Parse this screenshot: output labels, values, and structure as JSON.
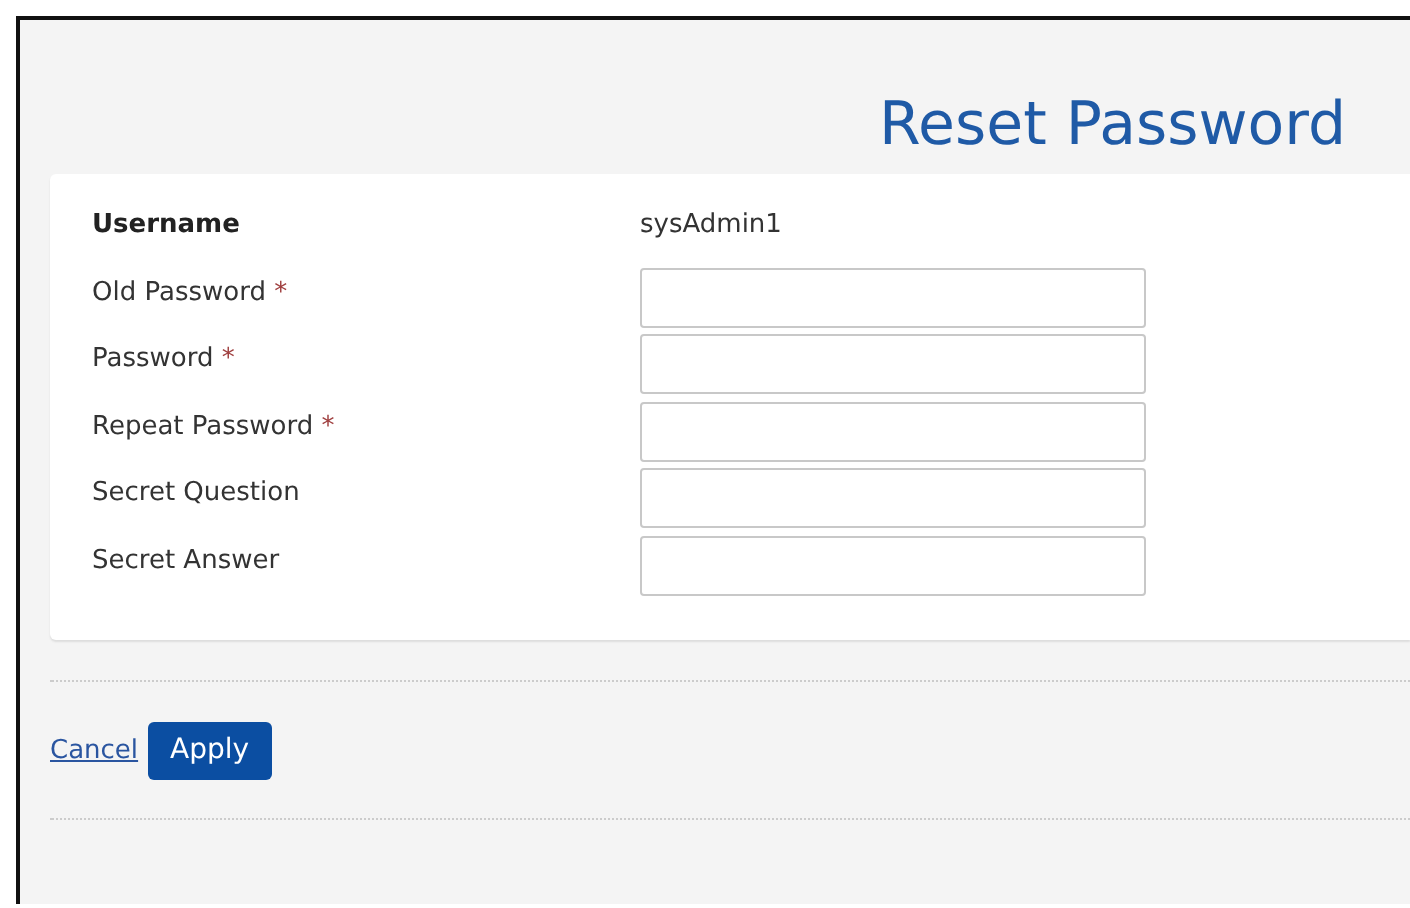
{
  "title": "Reset Password",
  "fields": [
    {
      "kind": "text",
      "label": "Username",
      "value": "sysAdmin1"
    },
    {
      "kind": "input",
      "label": "Old Password",
      "mark": "*"
    },
    {
      "kind": "input",
      "label": "Password",
      "mark": "*"
    },
    {
      "kind": "input",
      "label": "Repeat Password",
      "mark": "*"
    },
    {
      "kind": "input",
      "label": "Secret Question"
    },
    {
      "kind": "input",
      "label": "Secret Answer"
    }
  ],
  "actions": {
    "cancel": "Cancel",
    "apply": "Apply"
  }
}
